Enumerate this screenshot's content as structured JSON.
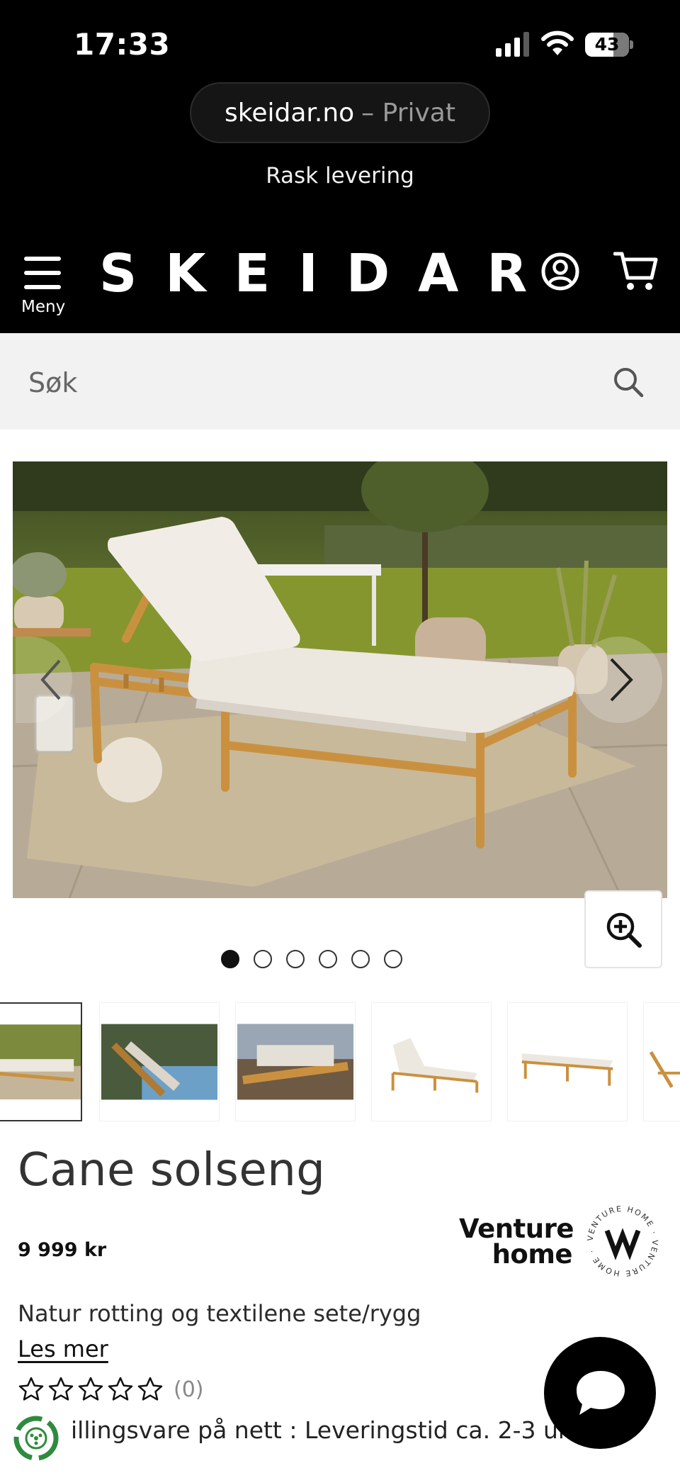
{
  "status_bar": {
    "time": "17:33",
    "battery": "43"
  },
  "browser": {
    "url_host": "skeidar.no",
    "url_mode": "– Privat"
  },
  "banner": {
    "text": "Rask levering"
  },
  "header": {
    "menu_label": "Meny",
    "logo": "SKEIDAR",
    "icons": [
      "hamburger-icon",
      "user-account-icon",
      "shopping-cart-icon"
    ]
  },
  "search": {
    "placeholder": "Søk",
    "icon": "search-icon"
  },
  "gallery": {
    "image_count": 6,
    "active_index": 0,
    "thumbnail_count": 6,
    "controls": [
      "chevron-left-icon",
      "chevron-right-icon",
      "zoom-in-icon"
    ]
  },
  "product": {
    "title": "Cane solseng",
    "price": "9 999 kr",
    "description": "Natur rotting og textilene sete/rygg",
    "read_more": "Les mer",
    "rating": {
      "stars": 0,
      "max": 5,
      "count_text": "(0)"
    },
    "delivery_text": "illingsvare på nett : Leveringstid ca. 2-3 uker"
  },
  "brand": {
    "line1": "Venture",
    "line2": "home",
    "seal_text": "VENTURE HOME"
  },
  "chat": {
    "icon": "chat-bubble-icon"
  },
  "colors": {
    "header_bg": "#000000",
    "search_bg": "#f2f2f2",
    "accent_green": "#2e8b3e"
  }
}
